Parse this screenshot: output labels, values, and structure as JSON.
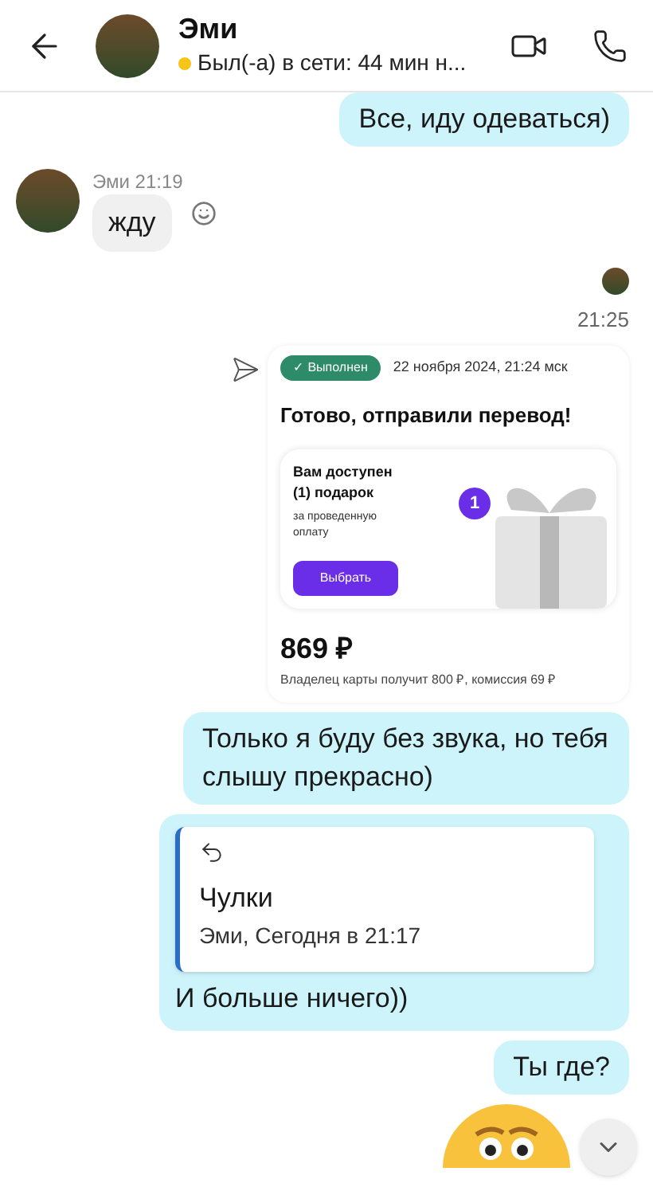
{
  "header": {
    "name": "Эми",
    "online": false,
    "status": "Был(-а) в сети: 44 мин н..."
  },
  "messages": [
    {
      "kind": "outgoing",
      "text": "Все, иду одеваться)"
    },
    {
      "kind": "incoming",
      "meta": "Эми 21:19",
      "text": "жду"
    },
    {
      "kind": "seen"
    },
    {
      "kind": "time",
      "text": "21:25"
    },
    {
      "kind": "receipt",
      "badge": "✓ Выполнен",
      "date": "22 ноября 2024, 21:24 мск",
      "title": "Готово, отправили перевод!",
      "promo_title": "Вам доступен (1) подарок",
      "promo_text": "за проведенную оплату",
      "promo_button": "Выбрать",
      "promo_count": "1",
      "amount": "869 ₽",
      "note": "Владелец карты получит 800 ₽, комиссия 69 ₽"
    },
    {
      "kind": "outgoing",
      "text": "Только я буду без звука, но тебя слышу прекрасно)"
    },
    {
      "kind": "reply",
      "quote_text": "Чулки",
      "quote_meta": "Эми, Сегодня в 21:17",
      "text": "И больше ничего))"
    },
    {
      "kind": "outgoing",
      "text": "Ты где?"
    },
    {
      "kind": "sticker"
    }
  ]
}
